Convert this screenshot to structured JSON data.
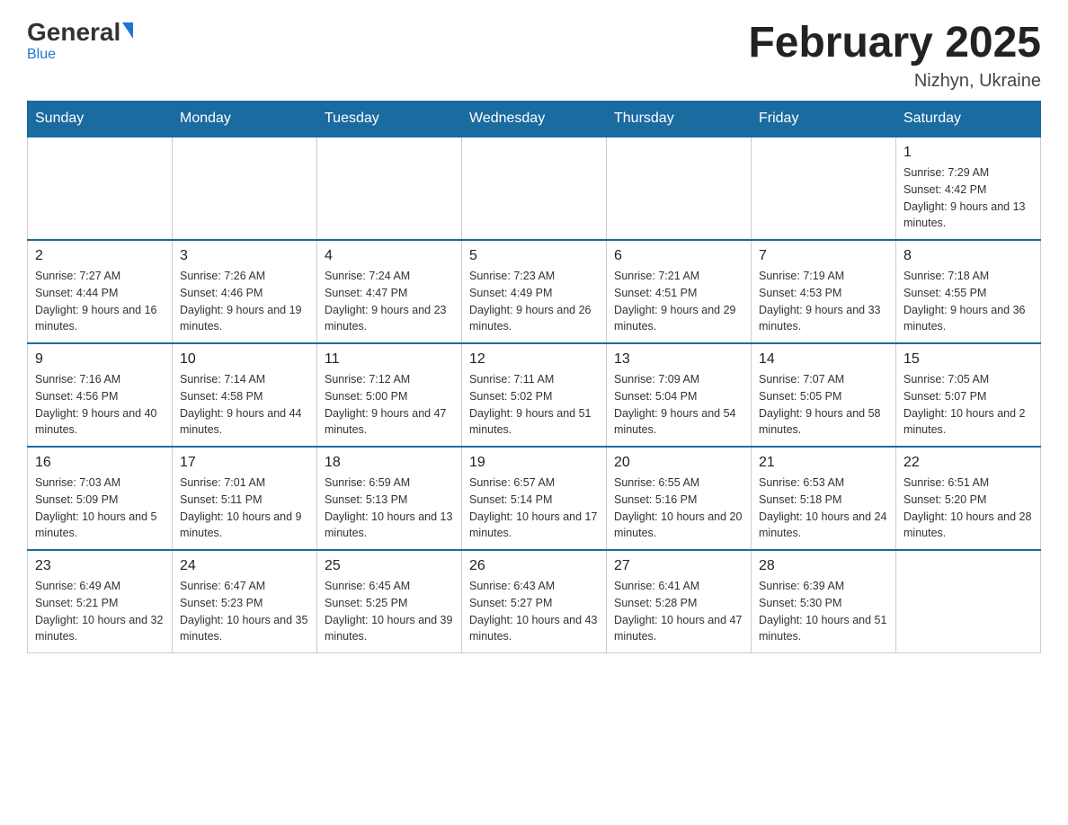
{
  "header": {
    "logo_general": "General",
    "logo_blue": "Blue",
    "month_title": "February 2025",
    "location": "Nizhyn, Ukraine"
  },
  "weekdays": [
    "Sunday",
    "Monday",
    "Tuesday",
    "Wednesday",
    "Thursday",
    "Friday",
    "Saturday"
  ],
  "weeks": [
    [
      {
        "day": "",
        "info": ""
      },
      {
        "day": "",
        "info": ""
      },
      {
        "day": "",
        "info": ""
      },
      {
        "day": "",
        "info": ""
      },
      {
        "day": "",
        "info": ""
      },
      {
        "day": "",
        "info": ""
      },
      {
        "day": "1",
        "info": "Sunrise: 7:29 AM\nSunset: 4:42 PM\nDaylight: 9 hours and 13 minutes."
      }
    ],
    [
      {
        "day": "2",
        "info": "Sunrise: 7:27 AM\nSunset: 4:44 PM\nDaylight: 9 hours and 16 minutes."
      },
      {
        "day": "3",
        "info": "Sunrise: 7:26 AM\nSunset: 4:46 PM\nDaylight: 9 hours and 19 minutes."
      },
      {
        "day": "4",
        "info": "Sunrise: 7:24 AM\nSunset: 4:47 PM\nDaylight: 9 hours and 23 minutes."
      },
      {
        "day": "5",
        "info": "Sunrise: 7:23 AM\nSunset: 4:49 PM\nDaylight: 9 hours and 26 minutes."
      },
      {
        "day": "6",
        "info": "Sunrise: 7:21 AM\nSunset: 4:51 PM\nDaylight: 9 hours and 29 minutes."
      },
      {
        "day": "7",
        "info": "Sunrise: 7:19 AM\nSunset: 4:53 PM\nDaylight: 9 hours and 33 minutes."
      },
      {
        "day": "8",
        "info": "Sunrise: 7:18 AM\nSunset: 4:55 PM\nDaylight: 9 hours and 36 minutes."
      }
    ],
    [
      {
        "day": "9",
        "info": "Sunrise: 7:16 AM\nSunset: 4:56 PM\nDaylight: 9 hours and 40 minutes."
      },
      {
        "day": "10",
        "info": "Sunrise: 7:14 AM\nSunset: 4:58 PM\nDaylight: 9 hours and 44 minutes."
      },
      {
        "day": "11",
        "info": "Sunrise: 7:12 AM\nSunset: 5:00 PM\nDaylight: 9 hours and 47 minutes."
      },
      {
        "day": "12",
        "info": "Sunrise: 7:11 AM\nSunset: 5:02 PM\nDaylight: 9 hours and 51 minutes."
      },
      {
        "day": "13",
        "info": "Sunrise: 7:09 AM\nSunset: 5:04 PM\nDaylight: 9 hours and 54 minutes."
      },
      {
        "day": "14",
        "info": "Sunrise: 7:07 AM\nSunset: 5:05 PM\nDaylight: 9 hours and 58 minutes."
      },
      {
        "day": "15",
        "info": "Sunrise: 7:05 AM\nSunset: 5:07 PM\nDaylight: 10 hours and 2 minutes."
      }
    ],
    [
      {
        "day": "16",
        "info": "Sunrise: 7:03 AM\nSunset: 5:09 PM\nDaylight: 10 hours and 5 minutes."
      },
      {
        "day": "17",
        "info": "Sunrise: 7:01 AM\nSunset: 5:11 PM\nDaylight: 10 hours and 9 minutes."
      },
      {
        "day": "18",
        "info": "Sunrise: 6:59 AM\nSunset: 5:13 PM\nDaylight: 10 hours and 13 minutes."
      },
      {
        "day": "19",
        "info": "Sunrise: 6:57 AM\nSunset: 5:14 PM\nDaylight: 10 hours and 17 minutes."
      },
      {
        "day": "20",
        "info": "Sunrise: 6:55 AM\nSunset: 5:16 PM\nDaylight: 10 hours and 20 minutes."
      },
      {
        "day": "21",
        "info": "Sunrise: 6:53 AM\nSunset: 5:18 PM\nDaylight: 10 hours and 24 minutes."
      },
      {
        "day": "22",
        "info": "Sunrise: 6:51 AM\nSunset: 5:20 PM\nDaylight: 10 hours and 28 minutes."
      }
    ],
    [
      {
        "day": "23",
        "info": "Sunrise: 6:49 AM\nSunset: 5:21 PM\nDaylight: 10 hours and 32 minutes."
      },
      {
        "day": "24",
        "info": "Sunrise: 6:47 AM\nSunset: 5:23 PM\nDaylight: 10 hours and 35 minutes."
      },
      {
        "day": "25",
        "info": "Sunrise: 6:45 AM\nSunset: 5:25 PM\nDaylight: 10 hours and 39 minutes."
      },
      {
        "day": "26",
        "info": "Sunrise: 6:43 AM\nSunset: 5:27 PM\nDaylight: 10 hours and 43 minutes."
      },
      {
        "day": "27",
        "info": "Sunrise: 6:41 AM\nSunset: 5:28 PM\nDaylight: 10 hours and 47 minutes."
      },
      {
        "day": "28",
        "info": "Sunrise: 6:39 AM\nSunset: 5:30 PM\nDaylight: 10 hours and 51 minutes."
      },
      {
        "day": "",
        "info": ""
      }
    ]
  ]
}
